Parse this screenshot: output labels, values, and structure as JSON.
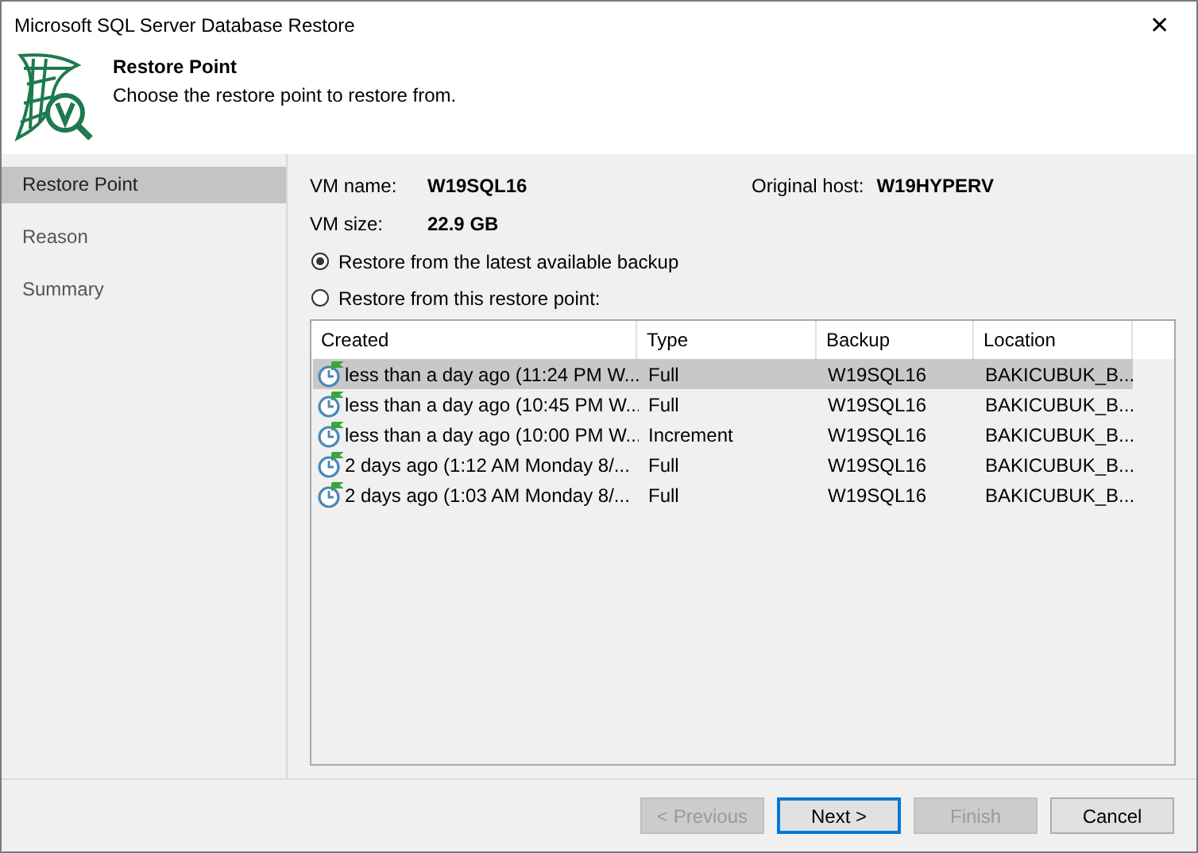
{
  "window": {
    "title": "Microsoft SQL Server Database Restore",
    "close": "✕"
  },
  "header": {
    "title": "Restore Point",
    "subtitle": "Choose the restore point to restore from."
  },
  "sidebar": {
    "items": [
      {
        "label": "Restore Point",
        "selected": true
      },
      {
        "label": "Reason",
        "selected": false
      },
      {
        "label": "Summary",
        "selected": false
      }
    ]
  },
  "vm": {
    "name_label": "VM name:",
    "name": "W19SQL16",
    "host_label": "Original host:",
    "host": "W19HYPERV",
    "size_label": "VM size:",
    "size": "22.9 GB"
  },
  "options": [
    {
      "label": "Restore from the latest available backup",
      "selected": true
    },
    {
      "label": "Restore from this restore point:",
      "selected": false
    }
  ],
  "table": {
    "columns": [
      "Created",
      "Type",
      "Backup",
      "Location"
    ],
    "rows": [
      {
        "cells": [
          "less than a day ago (11:24 PM W...",
          "Full",
          "W19SQL16",
          "BAKICUBUK_B..."
        ],
        "selected": true
      },
      {
        "cells": [
          "less than a day ago (10:45 PM W...",
          "Full",
          "W19SQL16",
          "BAKICUBUK_B..."
        ],
        "selected": false
      },
      {
        "cells": [
          "less than a day ago (10:00 PM W...",
          "Increment",
          "W19SQL16",
          "BAKICUBUK_B..."
        ],
        "selected": false
      },
      {
        "cells": [
          "2 days ago (1:12 AM Monday 8/...",
          "Full",
          "W19SQL16",
          "BAKICUBUK_B..."
        ],
        "selected": false
      },
      {
        "cells": [
          "2 days ago (1:03 AM Monday 8/...",
          "Full",
          "W19SQL16",
          "BAKICUBUK_B..."
        ],
        "selected": false
      }
    ]
  },
  "buttons": [
    {
      "label": "< Previous",
      "disabled": true,
      "default": false
    },
    {
      "label": "Next >",
      "disabled": false,
      "default": true
    },
    {
      "label": "Finish",
      "disabled": true,
      "default": false
    },
    {
      "label": "Cancel",
      "disabled": false,
      "default": false
    }
  ]
}
